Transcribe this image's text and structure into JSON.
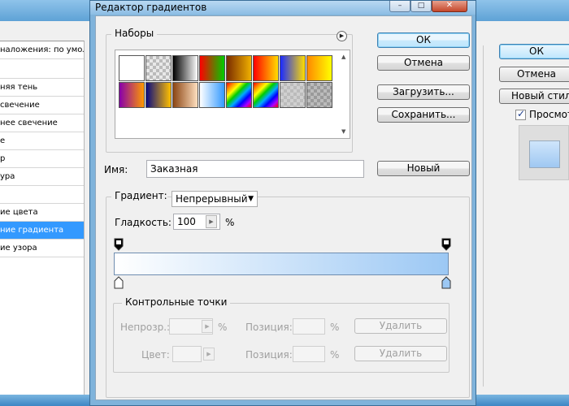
{
  "background_dialog": {
    "left_list": [
      "наложения: по умолча",
      "",
      "няя тень",
      "свечение",
      "нее свечение",
      "е",
      "р",
      "ура",
      "",
      "ие цвета",
      "ние градиента",
      "ие узора"
    ],
    "selected_index": 10,
    "buttons": {
      "ok": "ОК",
      "cancel": "Отмена",
      "new_style": "Новый стиль"
    },
    "preview_label": "Просмотр",
    "preview_checked": true
  },
  "dialog": {
    "title": "Редактор градиентов",
    "titlebar_buttons": {
      "minimize": "–",
      "maximize": "□",
      "close": "✕"
    },
    "presets_label": "Наборы",
    "preset_swatches": [
      [
        "#ffffff",
        "#ffffff"
      ],
      [
        "#e8e8e8",
        "checker"
      ],
      [
        "#000000",
        "#ffffff"
      ],
      [
        "#ff0000",
        "#00cc00"
      ],
      [
        "#7a2c00",
        "#f0b000"
      ],
      [
        "#ff0000",
        "#ffdd00"
      ],
      [
        "#1a2aff",
        "#ffdd00"
      ],
      [
        "#ff8800",
        "#ffff00"
      ],
      [
        "#8800aa",
        "#ff9900"
      ],
      [
        "#0a0a80",
        "#ffc000"
      ],
      [
        "#8b4513",
        "#ffe0c0"
      ],
      [
        "#ffffff",
        "#3399ff"
      ],
      [
        "rainbow",
        ""
      ],
      [
        "rainbow",
        ""
      ],
      [
        "#d0d0d0",
        "checker"
      ],
      [
        "#9a9a9a",
        "checker"
      ]
    ],
    "buttons": {
      "ok": "ОК",
      "cancel": "Отмена",
      "load": "Загрузить...",
      "save": "Сохранить...",
      "new": "Новый"
    },
    "name_label": "Имя:",
    "name_value": "Заказная",
    "gradient_type_label": "Градиент:",
    "gradient_type_value": "Непрерывный",
    "smoothness_label": "Гладкость:",
    "smoothness_value": "100",
    "percent_sign": "%",
    "gradient": {
      "start_color": "#ffffff",
      "end_color": "#9cc8f4"
    },
    "stops": {
      "label": "Контрольные точки",
      "opacity_label": "Непрозр.:",
      "opacity_value": "",
      "position_label": "Позиция:",
      "position_value": "",
      "color_label": "Цвет:",
      "delete_label": "Удалить",
      "percent_sign": "%"
    }
  },
  "colors": {
    "desktop": "#0a6fb8",
    "selection": "#3399ff"
  }
}
